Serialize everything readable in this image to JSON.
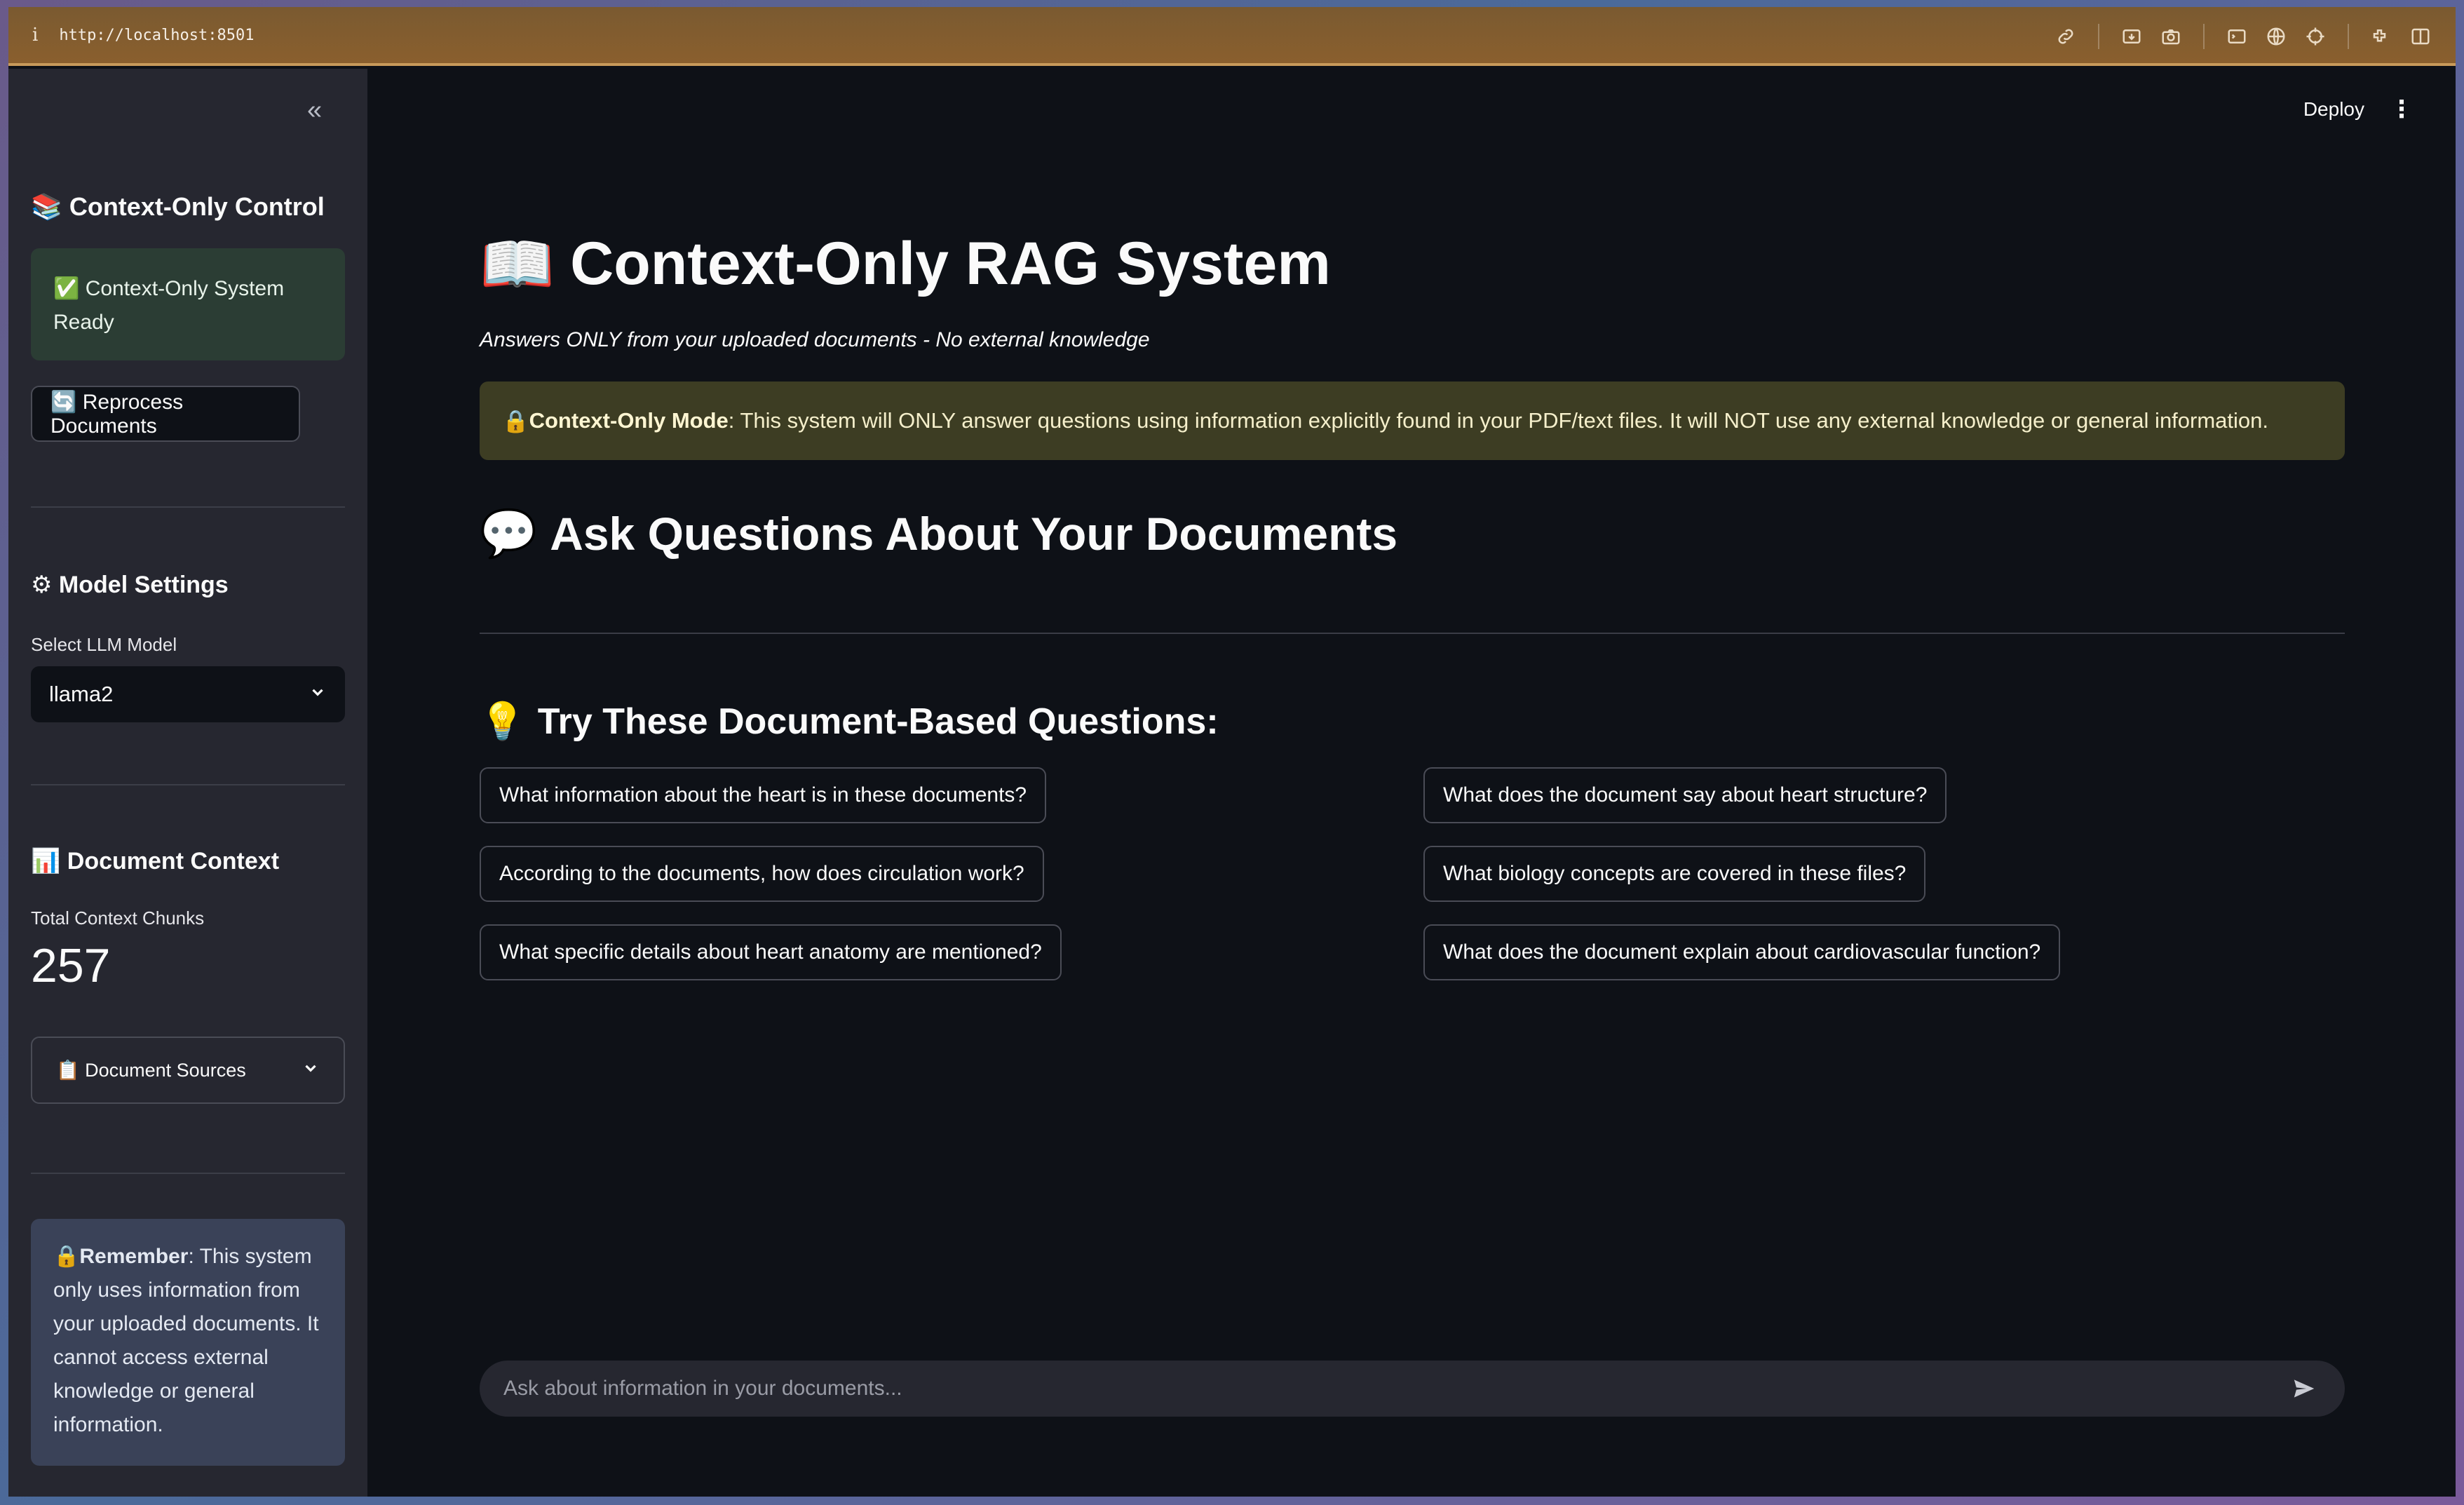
{
  "browser": {
    "info_glyph": "i",
    "url": "http://localhost:8501"
  },
  "sidebar": {
    "collapse_glyph": "«",
    "control_heading": "📚 Context-Only Control",
    "status_text": "✅ Context-Only System Ready",
    "reprocess_button": "🔄 Reprocess Documents",
    "model_heading": "⚙ Model Settings",
    "model_label": "Select LLM Model",
    "model_value": "llama2",
    "context_heading": "📊 Document Context",
    "chunks_label": "Total Context Chunks",
    "chunks_value": "257",
    "sources_label": "📋 Document Sources",
    "remember_bold": "Remember",
    "remember_text": ": This system only uses information from your uploaded documents. It cannot access external knowledge or general information."
  },
  "header": {
    "deploy_label": "Deploy",
    "menu_glyph": "⋮"
  },
  "main": {
    "title_icon": "📖",
    "title": "Context-Only RAG System",
    "subtitle": "Answers ONLY from your uploaded documents - No external knowledge",
    "warning_bold": "Context-Only Mode",
    "warning_text": ": This system will ONLY answer questions using information explicitly found in your PDF/text files. It will NOT use any external knowledge or general information.",
    "ask_icon": "💬",
    "ask_heading": "Ask Questions About Your Documents",
    "try_icon": "💡",
    "try_heading": "Try These Document-Based Questions:",
    "questions": [
      "What information about the heart is in these documents?",
      "What does the document say about heart structure?",
      "According to the documents, how does circulation work?",
      "What biology concepts are covered in these files?",
      "What specific details about heart anatomy are mentioned?",
      "What does the document explain about cardiovascular function?"
    ],
    "chat_placeholder": "Ask about information in your documents..."
  }
}
